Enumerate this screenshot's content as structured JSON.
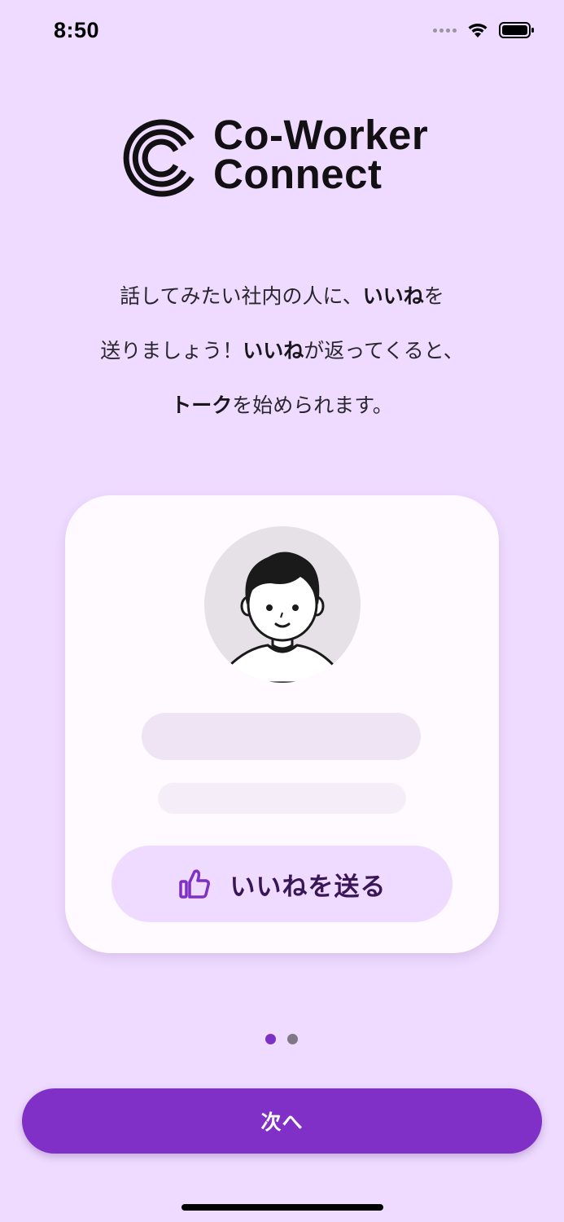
{
  "status_bar": {
    "time": "8:50"
  },
  "logo": {
    "line1": "Co-Worker",
    "line2": "Connect"
  },
  "intro": {
    "line1_a": "話してみたい社内の人に、",
    "line1_b": "いいね",
    "line1_c": "を",
    "line2_a": "送りましょう！",
    "line2_b": "いいね",
    "line2_c": "が返ってくると、",
    "line3_a": "トーク",
    "line3_b": "を始められます。"
  },
  "card": {
    "like_button_label": "いいねを送る",
    "like_icon": "thumbs-up-icon"
  },
  "pager": {
    "current_page": 1,
    "total_pages": 2
  },
  "next_button": {
    "label": "次へ"
  },
  "colors": {
    "background": "#EFDBFF",
    "accent": "#8130C7",
    "card": "#FEFAFF"
  }
}
